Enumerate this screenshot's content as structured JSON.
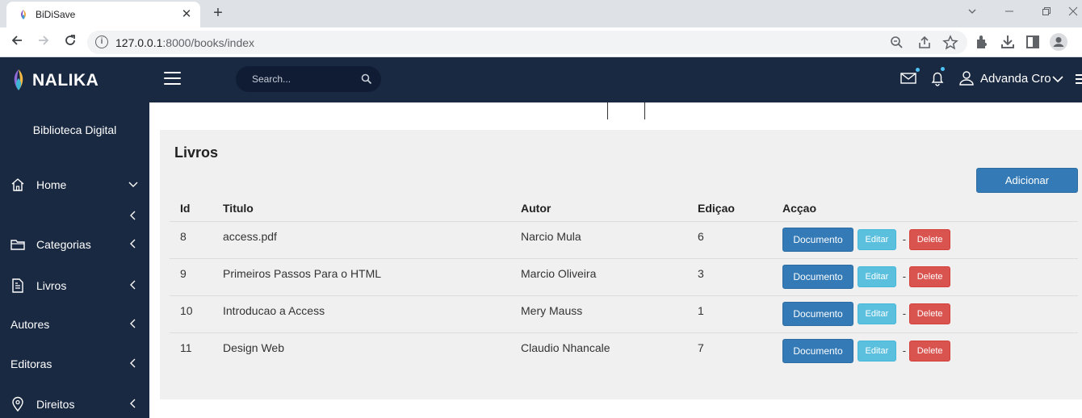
{
  "browser": {
    "tab_title": "BiDiSave",
    "url_host": "127.0.0.1",
    "url_path": ":8000/books/index",
    "new_tab": "+",
    "close_tab": "✕"
  },
  "header": {
    "brand": "NALIKA",
    "search_placeholder": "Search...",
    "user_name": "Advanda Cro",
    "notification_color": "#4fc3f7"
  },
  "sidebar": {
    "title": "Biblioteca Digital",
    "items": [
      {
        "label": "Home",
        "icon": "home-icon"
      },
      {
        "label": "Categorias",
        "icon": "folder-icon"
      },
      {
        "label": "Livros",
        "icon": "document-icon"
      },
      {
        "label": "Autores",
        "icon": ""
      },
      {
        "label": "Editoras",
        "icon": ""
      },
      {
        "label": "Direitos",
        "icon": "location-pin-icon"
      }
    ]
  },
  "main": {
    "title": "Livros",
    "add_label": "Adicionar",
    "columns": [
      "Id",
      "Titulo",
      "Autor",
      "Ediçao",
      "Acçao"
    ],
    "rows": [
      {
        "id": "8",
        "titulo": "access.pdf",
        "autor": "Narcio Mula",
        "edicao": "6"
      },
      {
        "id": "9",
        "titulo": "Primeiros Passos Para o HTML",
        "autor": "Marcio Oliveira",
        "edicao": "3"
      },
      {
        "id": "10",
        "titulo": "Introducao a Access",
        "autor": "Mery Mauss",
        "edicao": "1"
      },
      {
        "id": "11",
        "titulo": "Design Web",
        "autor": "Claudio Nhancale",
        "edicao": "7"
      }
    ],
    "action_labels": {
      "documento": "Documento",
      "editar": "Editar",
      "delete": "Delete",
      "separator": "-"
    }
  },
  "colors": {
    "nav_bg": "#1a2942",
    "primary": "#337ab7",
    "info": "#5bc0de",
    "danger": "#d9534f",
    "panel_bg": "#f0f0f0"
  }
}
